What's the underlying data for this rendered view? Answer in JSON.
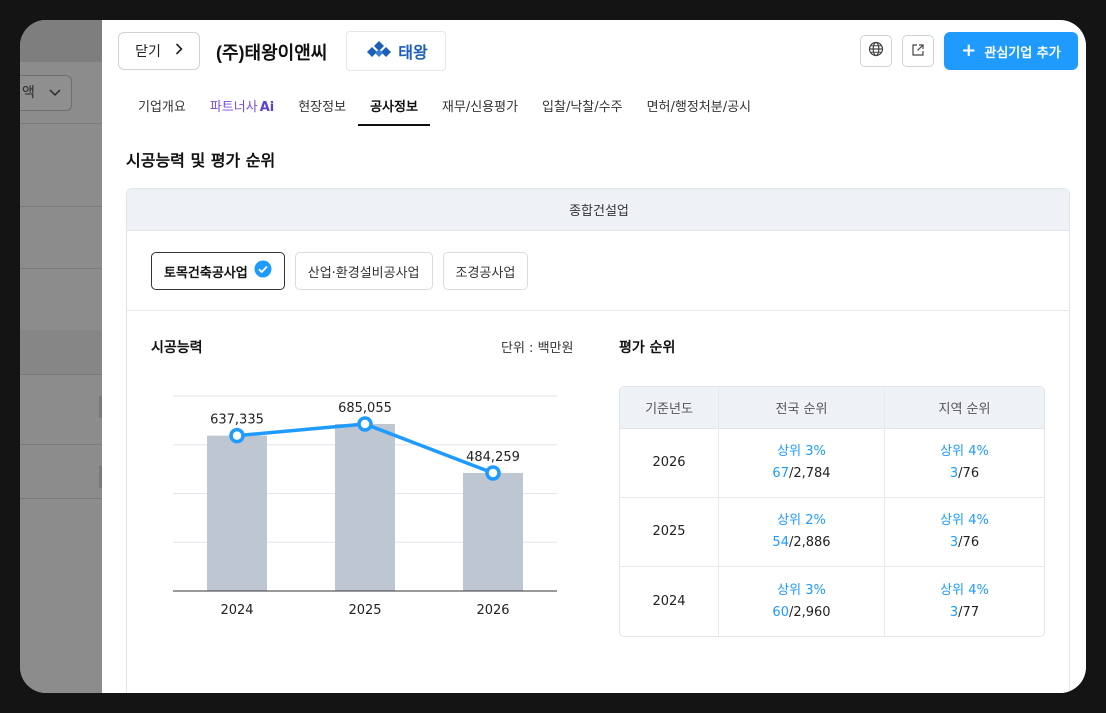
{
  "background": {
    "select_label": "액"
  },
  "header": {
    "close_label": "닫기",
    "company_name": "(주)태왕이앤씨",
    "logo_text": "태왕",
    "add_favorite_label": "관심기업 추가"
  },
  "tabs": [
    {
      "label": "기업개요"
    },
    {
      "label": "파트너사",
      "suffix": "Ai"
    },
    {
      "label": "현장정보"
    },
    {
      "label": "공사정보"
    },
    {
      "label": "재무/신용평가"
    },
    {
      "label": "입찰/낙찰/수주"
    },
    {
      "label": "면허/행정처분/공시"
    }
  ],
  "active_tab": "공사정보",
  "section_title": "시공능력 및 평가 순위",
  "card_header": "종합건설업",
  "chips": [
    {
      "label": "토목건축공사업",
      "selected": true
    },
    {
      "label": "산업·환경설비공사업",
      "selected": false
    },
    {
      "label": "조경공사업",
      "selected": false
    }
  ],
  "chart_title": "시공능력",
  "unit_label": "단위 : 백만원",
  "chart_data": {
    "type": "bar",
    "categories": [
      "2024",
      "2025",
      "2026"
    ],
    "values": [
      637335,
      685055,
      484259
    ],
    "value_labels": [
      "637,335",
      "685,055",
      "484,259"
    ],
    "line_overlay": true,
    "ylim": [
      0,
      800000
    ],
    "grid": true,
    "colors": {
      "bar": "#bec6d1",
      "line": "#1f9bff"
    }
  },
  "rank_title": "평가 순위",
  "rank_table": {
    "headers": [
      "기준년도",
      "전국 순위",
      "지역 순위"
    ],
    "rows": [
      {
        "year": "2026",
        "national_pct": "상위 3%",
        "national_rank": "67",
        "national_total": "/2,784",
        "regional_pct": "상위 4%",
        "regional_rank": "3",
        "regional_total": "/76"
      },
      {
        "year": "2025",
        "national_pct": "상위 2%",
        "national_rank": "54",
        "national_total": "/2,886",
        "regional_pct": "상위 4%",
        "regional_rank": "3",
        "regional_total": "/76"
      },
      {
        "year": "2024",
        "national_pct": "상위 3%",
        "national_rank": "60",
        "national_total": "/2,960",
        "regional_pct": "상위 4%",
        "regional_rank": "3",
        "regional_total": "/77"
      }
    ]
  },
  "colors": {
    "accent": "#1f9bff",
    "partner": "#7a4fd6",
    "logo": "#1d5fb8"
  }
}
